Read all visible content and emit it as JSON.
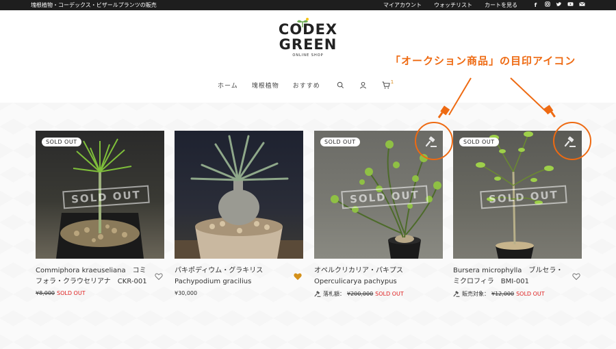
{
  "topbar": {
    "tagline": "塊根植物・コーデックス・ビザールプランツの販売",
    "links": [
      "マイアカウント",
      "ウォッチリスト",
      "カートを見る"
    ],
    "social_icons": [
      "facebook-icon",
      "instagram-icon",
      "twitter-icon",
      "youtube-icon",
      "mail-icon"
    ]
  },
  "logo": {
    "line1": "CODEX",
    "line2": "GREEN",
    "sub": "ONLINE SHOP"
  },
  "nav": {
    "items": [
      "ホーム",
      "塊根植物",
      "おすすめ"
    ],
    "cart_count": "1"
  },
  "annotation": {
    "text": "「オークション商品」の目印アイコン",
    "color": "#ee6a12"
  },
  "products": [
    {
      "badge": "SOLD OUT",
      "stamp": "SOLD OUT",
      "title": "Commiphora kraeuseliana　コミフォラ・クラウセリアナ　CKR-001",
      "price_label": "",
      "price": "¥8,000",
      "status": "SOLD OUT",
      "auction": false
    },
    {
      "badge": "",
      "stamp": "",
      "title_jp": "パキポディウム・グラキリス",
      "title_latin": "Pachypodium gracilius",
      "price_label": "",
      "price": "¥30,000",
      "status": "",
      "auction": false,
      "favorited": true
    },
    {
      "badge": "SOLD OUT",
      "stamp": "SOLD OUT",
      "title_jp": "オペルクリカリア・パキプス",
      "title_latin": "Operculicarya pachypus",
      "price_label": "落札額：",
      "price": "¥200,000",
      "status": "SOLD OUT",
      "auction": true
    },
    {
      "badge": "SOLD OUT",
      "stamp": "SOLD OUT",
      "title": "Bursera microphylla　ブルセラ・ミクロフィラ　BMI-001",
      "price_label": "販売対象：",
      "price": "¥12,000",
      "status": "SOLD OUT",
      "auction": true
    }
  ]
}
